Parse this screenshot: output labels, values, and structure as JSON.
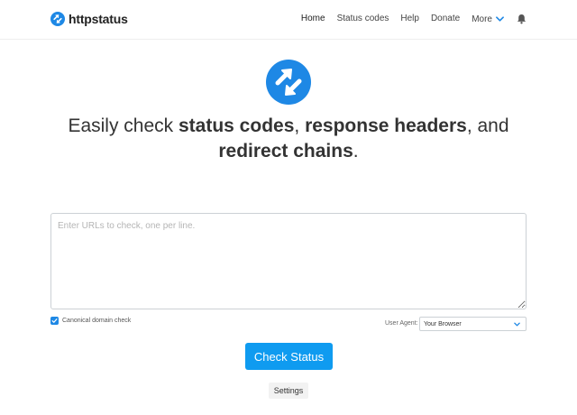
{
  "brand": {
    "name": "httpstatus",
    "logo_icon": "arrows-circle-icon",
    "color": "#1e88e5"
  },
  "nav": {
    "items": [
      {
        "label": "Home",
        "active": true
      },
      {
        "label": "Status codes"
      },
      {
        "label": "Help"
      },
      {
        "label": "Donate"
      }
    ],
    "more_label": "More",
    "more_icon": "chevron-down-icon",
    "bell_icon": "bell-icon",
    "accent": "#1e88e5"
  },
  "hero": {
    "icon": "arrows-circle-icon",
    "headline_parts": [
      {
        "text": "Easily check ",
        "bold": false
      },
      {
        "text": "status codes",
        "bold": true
      },
      {
        "text": ", ",
        "bold": false
      },
      {
        "text": "response headers",
        "bold": true
      },
      {
        "text": ", and ",
        "bold": false
      },
      {
        "text": "redirect chains",
        "bold": true
      },
      {
        "text": ".",
        "bold": false
      }
    ]
  },
  "form": {
    "urls_placeholder": "Enter URLs to check, one per line.",
    "urls_value": "",
    "canonical_label": "Canonical domain check",
    "canonical_checked": true,
    "user_agent_label": "User Agent:",
    "user_agent_value": "Your Browser",
    "submit_label": "Check Status",
    "settings_label": "Settings",
    "button_color": "#0f9bf0"
  }
}
